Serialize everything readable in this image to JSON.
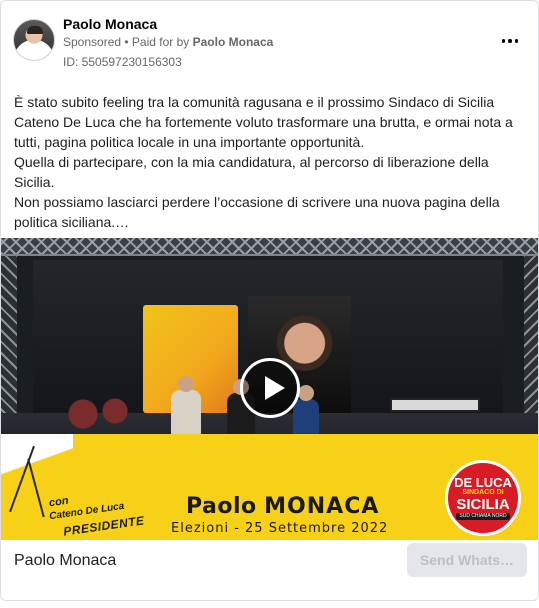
{
  "ad": {
    "advertiser_name": "Paolo Monaca",
    "sponsored_label": "Sponsored",
    "paid_for_prefix": " • Paid for by ",
    "paid_for_name": "Paolo Monaca",
    "ad_id_text": "ID: 550597230156303",
    "more_icon": "more-horizontal-icon",
    "body_paragraphs": [
      "È stato subito feeling tra la comunità ragusana e il prossimo Sindaco di Sicilia Cateno De Luca che ha fortemente voluto trasformare una brutta, e ormai nota a tutti, pagina politica locale in una importante opportunità.",
      "Quella di partecipare, con la mia candidatura, al percorso di liberazione della Sicilia.",
      "Non possiamo lasciarci perdere l’occasione di scrivere una nuova pagina della politica siciliana.…"
    ]
  },
  "media": {
    "play_icon": "play-icon",
    "banner": {
      "con_label": "con",
      "con_name": "Cateno De Luca",
      "con_title": "PRESIDENTE",
      "candidate_first": "Paolo",
      "candidate_last": "MONACA",
      "election_text": "Elezioni - 25 Settembre 2022"
    },
    "logo": {
      "line1": "DE LUCA",
      "line2": "SINDACO DI",
      "line3": "SICILIA",
      "line4": "SUD CHIAMA NORD"
    },
    "colors": {
      "banner_yellow": "#f7d117",
      "logo_red": "#d91b26"
    }
  },
  "footer": {
    "page_name": "Paolo Monaca",
    "cta_label": "Send Whats…"
  }
}
